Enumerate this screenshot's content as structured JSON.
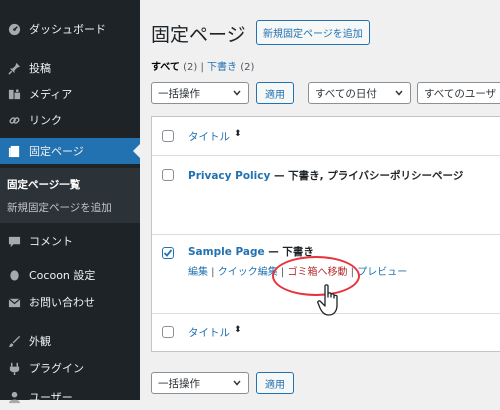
{
  "sidebar": {
    "items": [
      {
        "icon": "dashboard-icon",
        "label": "ダッシュボード"
      },
      {
        "icon": "pin-icon",
        "label": "投稿"
      },
      {
        "icon": "media-icon",
        "label": "メディア"
      },
      {
        "icon": "link-icon",
        "label": "リンク"
      },
      {
        "icon": "pages-icon",
        "label": "固定ページ",
        "active": true
      },
      {
        "icon": "comment-icon",
        "label": "コメント"
      },
      {
        "icon": "cocoon-icon",
        "label": "Cocoon 設定"
      },
      {
        "icon": "mail-icon",
        "label": "お問い合わせ"
      },
      {
        "icon": "appearance-icon",
        "label": "外観"
      },
      {
        "icon": "plugin-icon",
        "label": "プラグイン"
      },
      {
        "icon": "users-icon",
        "label": "ユーザー"
      }
    ],
    "submenu": [
      {
        "label": "固定ページ一覧",
        "current": true
      },
      {
        "label": "新規固定ページを追加",
        "current": false
      }
    ]
  },
  "header": {
    "title": "固定ページ",
    "add_new_label": "新規固定ページを追加"
  },
  "filters": {
    "all_label": "すべて",
    "all_count": "(2)",
    "separator": "|",
    "draft_label": "下書き",
    "draft_count": "(2)"
  },
  "top_actions": {
    "bulk_select": "一括操作",
    "apply_label": "適用",
    "date_select": "すべての日付",
    "user_select": "すべてのユーザ"
  },
  "table": {
    "column_title": "タイトル",
    "sort_glyph": "⬍",
    "rows": [
      {
        "title": "Privacy Policy",
        "state": " — 下書き, プライバシーポリシーページ",
        "checked": false
      },
      {
        "title": "Sample Page",
        "state": " — 下書き",
        "checked": true,
        "actions": {
          "edit": "編集",
          "quick_edit": "クイック編集",
          "trash": "ゴミ箱へ移動",
          "preview": "プレビュー",
          "sep": " | "
        }
      }
    ]
  },
  "bottom_actions": {
    "bulk_select": "一括操作",
    "apply_label": "適用"
  },
  "colors": {
    "sidebar_bg": "#1d2327",
    "active_bg": "#2271b1",
    "link": "#2271b1",
    "trash": "#b32d2e",
    "highlight": "#e8323c"
  }
}
